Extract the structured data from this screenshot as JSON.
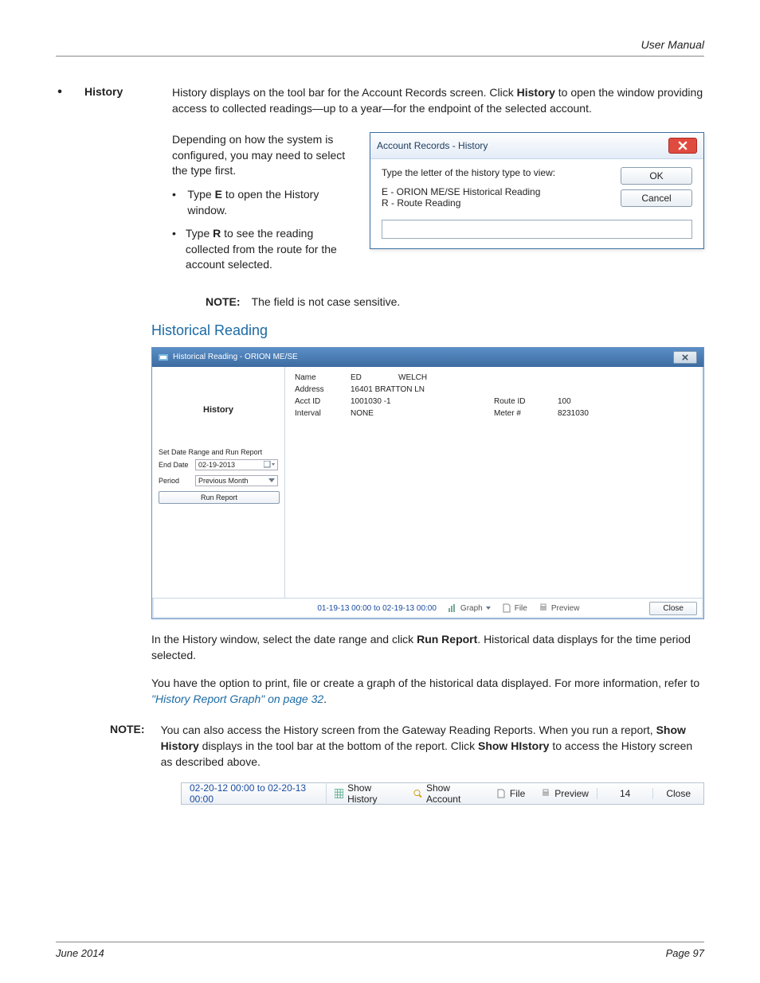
{
  "header": {
    "title": "User Manual"
  },
  "section": {
    "topic": "History",
    "intro1": "History displays on the tool bar for the Account Records screen. Click ",
    "intro_bold": "History",
    "intro2": " to open the window providing access to collected readings—up to a year—for the endpoint of the selected account.",
    "depends": "Depending on how the system is configured, you may need to select the type first.",
    "type_e_pre": "Type ",
    "type_e_key": "E",
    "type_e_post": " to open the History window.",
    "type_r_pre": "Type ",
    "type_r_key": "R",
    "type_r_post": " to see the reading collected from the route for the account selected.",
    "note_label": "NOTE:",
    "note_text": "The field is not case sensitive."
  },
  "dialog1": {
    "title": "Account Records - History",
    "prompt": "Type the letter of the history type to view:",
    "opt_e": "E - ORION ME/SE Historical Reading",
    "opt_r": "R - Route Reading",
    "ok": "OK",
    "cancel": "Cancel",
    "input_value": ""
  },
  "heading2": "Historical Reading",
  "dialog2": {
    "title": "Historical Reading - ORION ME/SE",
    "side_title": "History",
    "side_section": "Set Date Range and Run Report",
    "end_date_label": "End Date",
    "end_date_value": "02-19-2013",
    "period_label": "Period",
    "period_value": "Previous Month",
    "run_btn": "Run Report",
    "fields": {
      "name_lbl": "Name",
      "name_v1": "ED",
      "name_v2": "WELCH",
      "addr_lbl": "Address",
      "addr_v": "16401 BRATTON LN",
      "acct_lbl": "Acct ID",
      "acct_v": "1001030 -1",
      "route_lbl": "Route ID",
      "route_v": "100",
      "int_lbl": "Interval",
      "int_v": "NONE",
      "meter_lbl": "Meter #",
      "meter_v": "8231030"
    },
    "footer": {
      "range": "01-19-13 00:00 to 02-19-13 00:00",
      "graph": "Graph",
      "file": "File",
      "preview": "Preview",
      "close": "Close"
    }
  },
  "paras": {
    "p1a": "In the History window, select the date range and click ",
    "p1b": "Run Report",
    "p1c": ". Historical data displays for the time period selected.",
    "p2a": "You have the option to print, file or create a graph of the historical data displayed. For more information, refer to ",
    "p2link": "\"History Report Graph\" on page 32",
    "p2b": "."
  },
  "note2": {
    "label": "NOTE:",
    "a": "You can also access the History screen from the Gateway Reading Reports. When you run a report, ",
    "b1": "Show History",
    "c": " displays in the tool bar at the bottom of the report. Click ",
    "b2": "Show HIstory",
    "d": " to access the History screen as described above."
  },
  "toolbar": {
    "range": "02-20-12 00:00 to 02-20-13 00:00",
    "show_history": "Show History",
    "show_account": "Show Account",
    "file": "File",
    "preview": "Preview",
    "count": "14",
    "close": "Close"
  },
  "footer": {
    "left": "June 2014",
    "right": "Page 97"
  }
}
